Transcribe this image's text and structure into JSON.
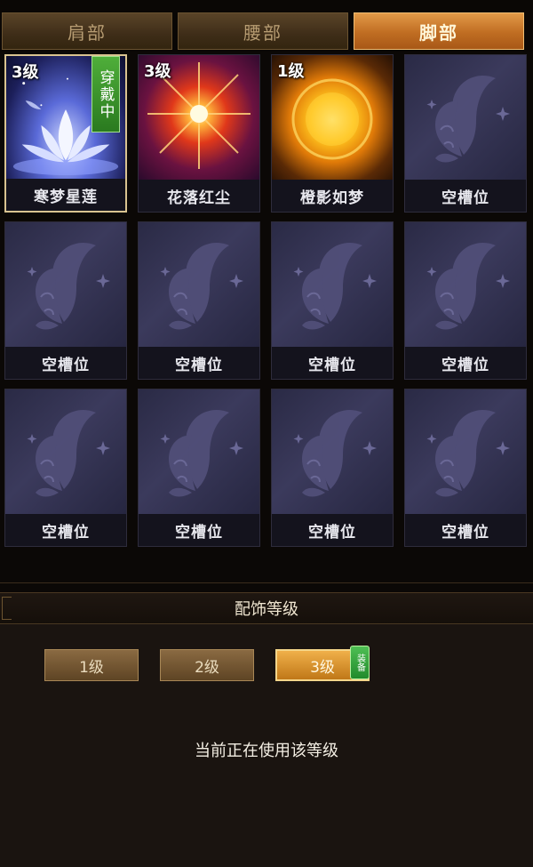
{
  "tabs": [
    {
      "label": "肩部",
      "active": false
    },
    {
      "label": "腰部",
      "active": false
    },
    {
      "label": "脚部",
      "active": true
    }
  ],
  "slots": [
    {
      "name": "寒梦星莲",
      "level": "3级",
      "badge": "穿戴中",
      "icon": "lotus-icon"
    },
    {
      "name": "花落红尘",
      "level": "3级",
      "icon": "red-burst-icon"
    },
    {
      "name": "橙影如梦",
      "level": "1级",
      "icon": "sun-icon"
    },
    {
      "name": "空槽位",
      "icon": "butterfly-icon"
    },
    {
      "name": "空槽位",
      "icon": "butterfly-icon"
    },
    {
      "name": "空槽位",
      "icon": "butterfly-icon"
    },
    {
      "name": "空槽位",
      "icon": "butterfly-icon"
    },
    {
      "name": "空槽位",
      "icon": "butterfly-icon"
    },
    {
      "name": "空槽位",
      "icon": "butterfly-icon"
    },
    {
      "name": "空槽位",
      "icon": "butterfly-icon"
    },
    {
      "name": "空槽位",
      "icon": "butterfly-icon"
    },
    {
      "name": "空槽位",
      "icon": "butterfly-icon"
    }
  ],
  "section": {
    "title": "配饰等级"
  },
  "levels": [
    {
      "label": "1级",
      "active": false
    },
    {
      "label": "2级",
      "active": false
    },
    {
      "label": "3级",
      "active": true,
      "tag": "装备"
    }
  ],
  "status_text": "当前正在使用该等级",
  "colors": {
    "accent": "#c87a2a",
    "badge_green": "#3a9a2c",
    "selected_border": "#d9c390"
  }
}
